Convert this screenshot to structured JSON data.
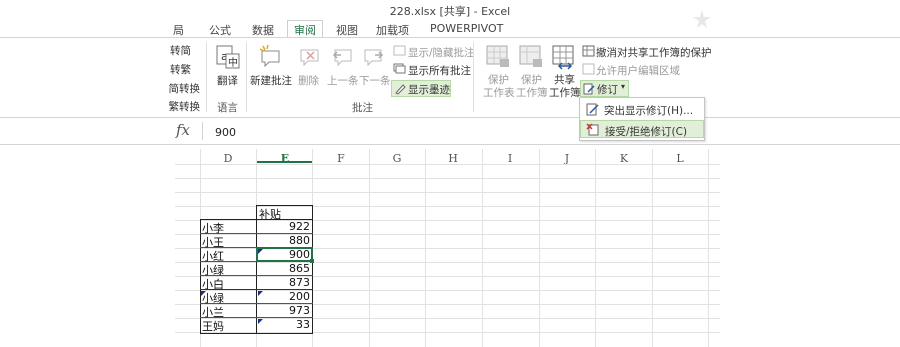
{
  "window": {
    "title": "228.xlsx  [共享] - Excel"
  },
  "tabs": [
    {
      "label": "布局",
      "partial": "局"
    },
    {
      "label": "公式"
    },
    {
      "label": "数据"
    },
    {
      "label": "审阅",
      "active": true
    },
    {
      "label": "视图"
    },
    {
      "label": "加载项"
    },
    {
      "label": "POWERPIVOT"
    }
  ],
  "ribbon": {
    "left_items": [
      "转简",
      "转繁",
      "简转换",
      "繁转换"
    ],
    "translate_label": "翻译",
    "groups": {
      "language": "语言",
      "comments": "批注"
    },
    "comments": {
      "new": "新建批注",
      "delete": "删除",
      "prev": "上一条",
      "next": "下一条",
      "show_hide": "显示/隐藏批注",
      "show_all": "显示所有批注",
      "show_ink": "显示墨迹"
    },
    "protect": {
      "protect_sheet_1": "保护",
      "protect_sheet_2": "工作表",
      "protect_book_1": "保护",
      "protect_book_2": "工作簿",
      "share_book_1": "共享",
      "share_book_2": "工作簿",
      "unprotect_shared": "撤消对共享工作簿的保护",
      "allow_edit": "允许用户编辑区域",
      "track_changes": "修订"
    }
  },
  "track_menu": {
    "items": [
      "突出显示修订(H)...",
      "接受/拒绝修订(C)"
    ],
    "highlighted": 1
  },
  "formula_bar": {
    "fx": "fx",
    "value": "900"
  },
  "columns": [
    "D",
    "E",
    "F",
    "G",
    "H",
    "I",
    "J",
    "K",
    "L"
  ],
  "selected_column": "E",
  "table": {
    "header": "补贴",
    "rows": [
      {
        "name": "小李",
        "value": "922"
      },
      {
        "name": "小王",
        "value": "880"
      },
      {
        "name": "小红",
        "value": "900"
      },
      {
        "name": "小绿",
        "value": "865"
      },
      {
        "name": "小白",
        "value": "873"
      },
      {
        "name": "小绿",
        "value": "200"
      },
      {
        "name": "小兰",
        "value": "973"
      },
      {
        "name": "王妈",
        "value": "33"
      }
    ]
  },
  "colors": {
    "accent": "#217346",
    "highlight": "#e1efd8",
    "comment_marker": "#1c2e8c"
  }
}
